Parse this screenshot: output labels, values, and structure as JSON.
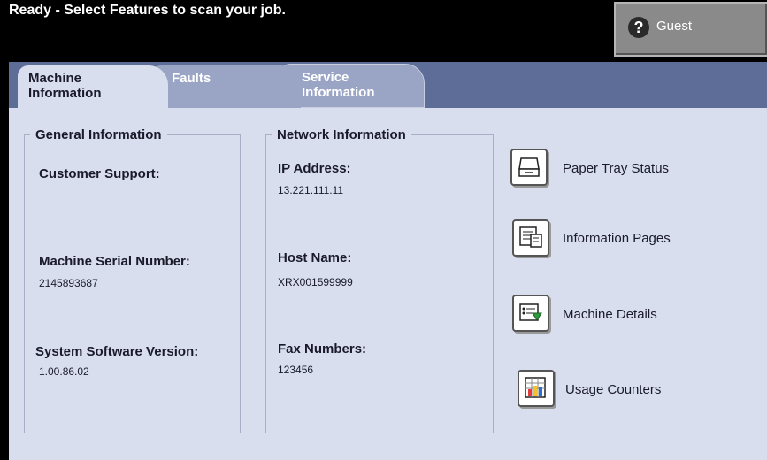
{
  "status": {
    "text": "Ready - Select Features to scan your job."
  },
  "user": {
    "label": "Guest",
    "icon": "help-icon"
  },
  "tabs": [
    {
      "label_line1": "Machine",
      "label_line2": "Information",
      "active": true
    },
    {
      "label_line1": "Faults",
      "label_line2": "",
      "active": false
    },
    {
      "label_line1": "Service",
      "label_line2": "Information",
      "active": false
    }
  ],
  "general": {
    "title": "General Information",
    "customer_support_label": "Customer Support:",
    "customer_support_value": "",
    "serial_label": "Machine Serial Number:",
    "serial_value": "2145893687",
    "software_label": "System Software Version:",
    "software_value": "1.00.86.02"
  },
  "network": {
    "title": "Network Information",
    "ip_label": "IP Address:",
    "ip_value": "13.221.111.11",
    "host_label": "Host Name:",
    "host_value": "XRX001599999",
    "fax_label": "Fax Numbers:",
    "fax_value": "123456"
  },
  "actions": [
    {
      "label": "Paper Tray Status",
      "icon": "paper-tray-icon"
    },
    {
      "label": "Information Pages",
      "icon": "information-pages-icon"
    },
    {
      "label": "Machine Details",
      "icon": "machine-details-icon"
    },
    {
      "label": "Usage Counters",
      "icon": "usage-counters-icon"
    }
  ],
  "colors": {
    "tab_bar": "#5d6d98",
    "panel": "#d8deed",
    "tab_inactive": "#9aa5c6"
  }
}
